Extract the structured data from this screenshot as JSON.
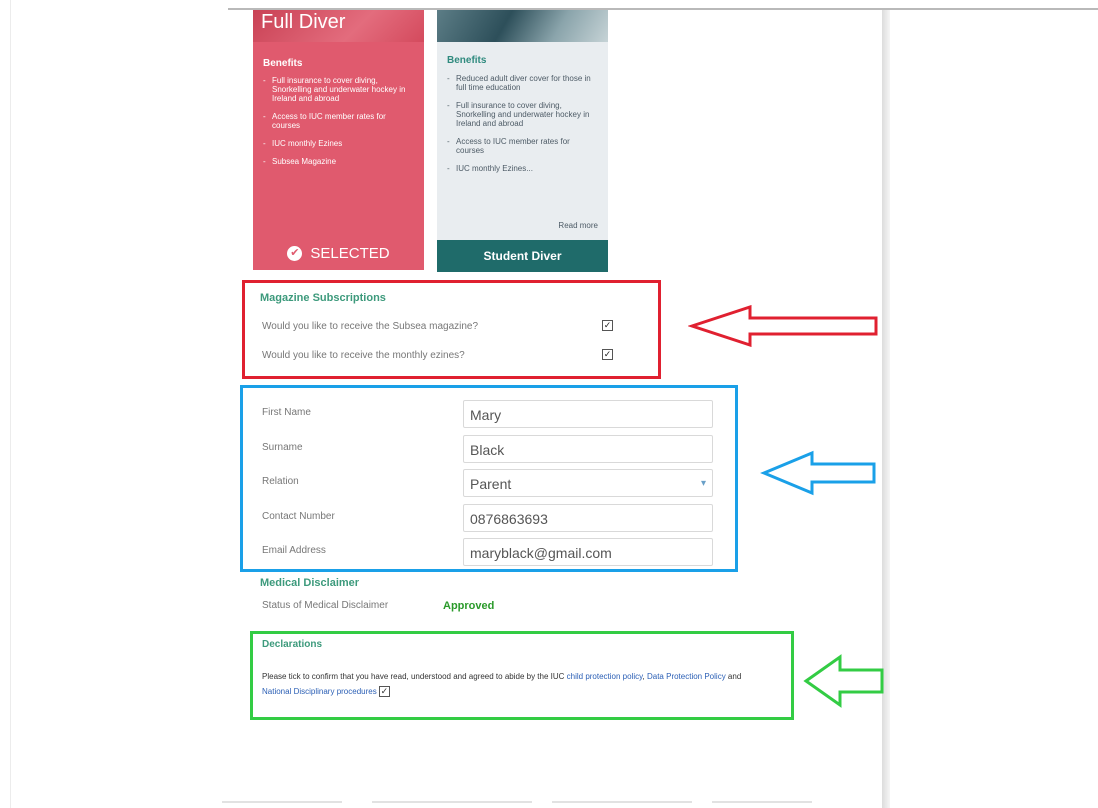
{
  "plans": {
    "full_diver": {
      "title": "Full Diver",
      "benefits_heading": "Benefits",
      "benefits": [
        "Full insurance to cover diving, Snorkelling and underwater hockey in Ireland and abroad",
        "Access to IUC member rates for courses",
        "IUC monthly Ezines",
        "Subsea Magazine"
      ],
      "button_label": "SELECTED",
      "color": "#e05a6e"
    },
    "student_diver": {
      "benefits_heading": "Benefits",
      "benefits": [
        "Reduced adult diver cover for those in full time education",
        "Full insurance to cover diving, Snorkelling and underwater hockey in Ireland and abroad",
        "Access to IUC member rates for courses",
        "IUC monthly Ezines..."
      ],
      "read_more": "Read more",
      "button_label": "Student Diver",
      "color": "#1f6b6a"
    }
  },
  "magazine": {
    "heading": "Magazine Subscriptions",
    "questions": [
      {
        "label": "Would you like to receive the Subsea magazine?",
        "checked": true
      },
      {
        "label": "Would you like to receive the monthly ezines?",
        "checked": true
      }
    ]
  },
  "contact": {
    "fields": [
      {
        "label": "First Name",
        "value": "Mary"
      },
      {
        "label": "Surname",
        "value": "Black"
      },
      {
        "label": "Relation",
        "value": "Parent"
      },
      {
        "label": "Contact Number",
        "value": "0876863693"
      },
      {
        "label": "Email Address",
        "value": "maryblack@gmail.com"
      }
    ]
  },
  "medical": {
    "heading": "Medical Disclaimer",
    "status_label": "Status of Medical Disclaimer",
    "status_value": "Approved"
  },
  "declarations": {
    "heading": "Declarations",
    "text_before": "Please tick to confirm that you have read, understood and agreed to abide by the IUC",
    "link_child_protection": "child protection policy",
    "link_data_protection": "Data Protection Policy",
    "text_and": "and",
    "link_disciplinary": "National Disciplinary procedures",
    "checked": true
  },
  "annotation_colors": {
    "red": "#e02030",
    "blue": "#1aa0e8",
    "green": "#33cc44"
  }
}
